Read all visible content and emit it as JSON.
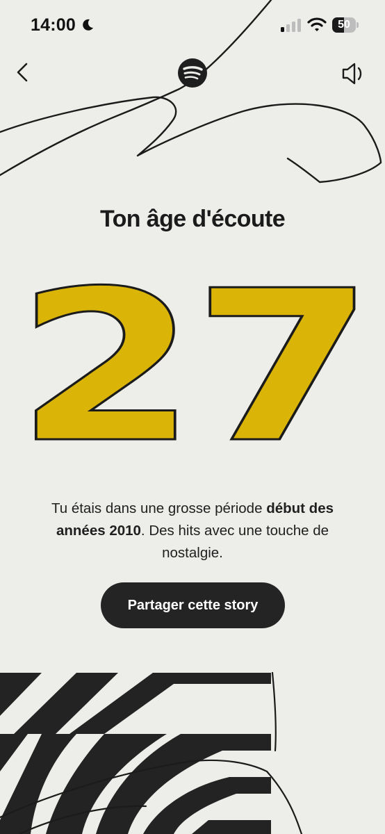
{
  "status_bar": {
    "time": "14:00",
    "battery_level": "50",
    "battery_fraction": 0.5
  },
  "icons": {
    "back": "chevron-left-icon",
    "logo": "spotify-logo",
    "sound": "speaker-icon",
    "moon": "moon-icon",
    "signal": "cellular-signal-icon",
    "wifi": "wifi-icon"
  },
  "story": {
    "title": "Ton âge d'écoute",
    "age": "27",
    "description_prefix": "Tu étais dans une grosse période ",
    "description_bold": "début des années 2010",
    "description_suffix": ". Des hits avec une touche de nostalgie.",
    "share_label": "Partager cette story"
  },
  "colors": {
    "background": "#edede9",
    "number_fill": "#dab508",
    "ink": "#1f1f1f",
    "button": "#242424"
  }
}
